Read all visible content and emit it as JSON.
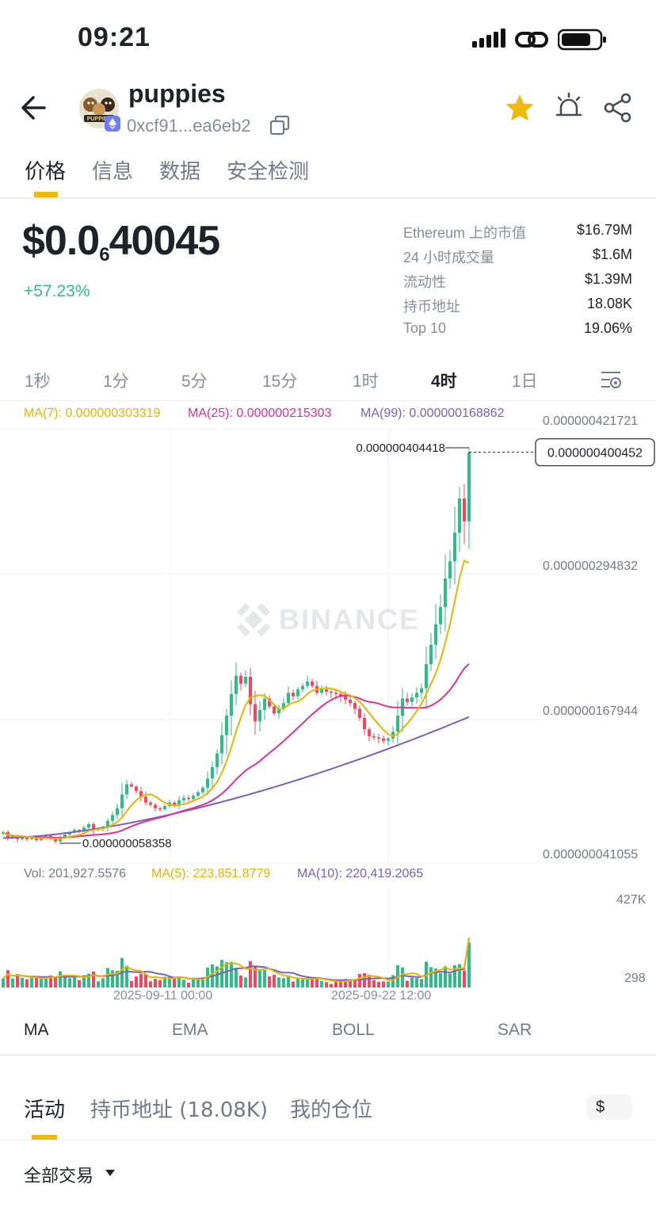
{
  "status_bar": {
    "time": "09:21"
  },
  "header": {
    "token_name": "puppies",
    "address": "0xcf91...ea6eb2",
    "avatar_text": "PUPPIES"
  },
  "tabs": [
    "价格",
    "信息",
    "数据",
    "安全检测"
  ],
  "price": {
    "prefix": "$0.0",
    "zeros": "6",
    "digits": "40045",
    "change": "+57.23%"
  },
  "stats": [
    {
      "label": "Ethereum 上的市值",
      "value": "$16.79M"
    },
    {
      "label": "24 小时成交量",
      "value": "$1.6M"
    },
    {
      "label": "流动性",
      "value": "$1.39M"
    },
    {
      "label": "持币地址",
      "value": "18.08K"
    },
    {
      "label": "Top 10",
      "value": "19.06%"
    }
  ],
  "intervals": [
    "1秒",
    "1分",
    "5分",
    "15分",
    "1时",
    "4时",
    "1日"
  ],
  "active_interval": "4时",
  "ma_legend": {
    "ma7": "MA(7): 0.000000303319",
    "ma25": "MA(25): 0.000000215303",
    "ma99": "MA(99): 0.000000168862"
  },
  "y_axis": [
    "0.000000421721",
    "0.000000294832",
    "0.000000167944",
    "0.000000041055"
  ],
  "price_annotations": {
    "high": "0.000000404418",
    "low": "0.000000058358",
    "current": "0.000000400452"
  },
  "watermark": "BINANCE",
  "volume_legend": {
    "vol": "Vol: 201,927.5576",
    "ma5": "MA(5): 223,851.8779",
    "ma10": "MA(10): 220,419.2065"
  },
  "volume_axis": {
    "top": "427K",
    "bottom": "298"
  },
  "x_axis": [
    "2025-09-11 00:00",
    "2025-09-22 12:00"
  ],
  "indicators": [
    "MA",
    "EMA",
    "BOLL",
    "SAR"
  ],
  "bottom_tabs": [
    "活动",
    "持币地址 (18.08K)",
    "我的仓位"
  ],
  "currency": "$",
  "filter": "全部交易",
  "colors": {
    "up": "#2ebd85",
    "down": "#f6465d",
    "accent": "#f0b90b",
    "ma7": "#e8b400",
    "ma25": "#e0309a",
    "ma99": "#7b5fc0"
  },
  "chart_data": {
    "type": "candlestick",
    "interval": "4h",
    "x_labels": [
      "2025-09-11 00:00",
      "2025-09-22 12:00"
    ],
    "ylim": [
      4.1055e-08,
      4.21721e-07
    ],
    "y_ticks": [
      4.21721e-07,
      2.94832e-07,
      1.67944e-07,
      4.1055e-08
    ],
    "close_trend": [
      6.8e-08,
      6.3e-08,
      6.5e-08,
      6.2e-08,
      6.4e-08,
      6.2e-08,
      6.3e-08,
      6.1e-08,
      6.3e-08,
      6.5e-08,
      6.2e-08,
      6e-08,
      6.4e-08,
      6.6e-08,
      6.8e-08,
      7e-08,
      6.9e-08,
      7.2e-08,
      7.5e-08,
      7e-08,
      7.1e-08,
      7.3e-08,
      7.8e-08,
      8.3e-08,
      8.9e-08,
      1.01e-07,
      1.1e-07,
      1.08e-07,
      1.04e-07,
      9.9e-08,
      9.4e-08,
      9.2e-08,
      8.9e-08,
      8.8e-08,
      9.1e-08,
      9.4e-08,
      9.2e-08,
      9.6e-08,
      9.8e-08,
      9.7e-08,
      1e-07,
      1.03e-07,
      1.07e-07,
      1.15e-07,
      1.25e-07,
      1.37e-07,
      1.53e-07,
      1.7e-07,
      1.89e-07,
      2.05e-07,
      1.98e-07,
      2.04e-07,
      1.8e-07,
      1.65e-07,
      1.75e-07,
      1.85e-07,
      1.78e-07,
      1.72e-07,
      1.76e-07,
      1.81e-07,
      1.9e-07,
      1.87e-07,
      1.93e-07,
      1.96e-07,
      2e-07,
      1.96e-07,
      1.9e-07,
      1.93e-07,
      1.91e-07,
      1.9e-07,
      1.89e-07,
      1.87e-07,
      1.84e-07,
      1.81e-07,
      1.76e-07,
      1.68e-07,
      1.58e-07,
      1.52e-07,
      1.51e-07,
      1.5e-07,
      1.48e-07,
      1.5e-07,
      1.56e-07,
      1.7e-07,
      1.85e-07,
      1.82e-07,
      1.86e-07,
      1.9e-07,
      1.94e-07,
      2.15e-07,
      2.32e-07,
      2.5e-07,
      2.65e-07,
      2.9e-07,
      3.05e-07,
      3.3e-07,
      3.6e-07,
      3.4e-07,
      4.00452e-07
    ],
    "ma7_last": 3.03319e-07,
    "ma25_last": 2.15303e-07,
    "ma99_last": 1.68862e-07,
    "high": 4.04418e-07,
    "low": 5.8358e-08,
    "last": 4.00452e-07,
    "volume_ylim": [
      298,
      427000
    ],
    "volume_last": 201927.5576,
    "volume_ma5_last": 223851.8779,
    "volume_ma10_last": 220419.2065
  }
}
